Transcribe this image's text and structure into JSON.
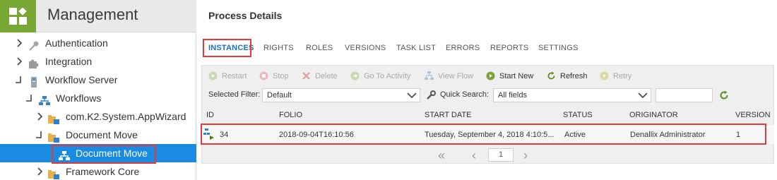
{
  "sidebar": {
    "title": "Management",
    "items": [
      {
        "label": "Authentication",
        "expander": "›"
      },
      {
        "label": "Integration",
        "expander": "›"
      },
      {
        "label": "Workflow Server",
        "expander": "⌟"
      },
      {
        "label": "Workflows",
        "expander": "⌟"
      },
      {
        "label": "com.K2.System.AppWizard",
        "expander": "›"
      },
      {
        "label": "Document Move",
        "expander": "⌟"
      },
      {
        "label": "Document Move",
        "expander": ""
      },
      {
        "label": "Framework Core",
        "expander": "›"
      }
    ]
  },
  "main": {
    "title": "Process Details",
    "tabs": [
      "INSTANCES",
      "RIGHTS",
      "ROLES",
      "VERSIONS",
      "TASK LIST",
      "ERRORS",
      "REPORTS",
      "SETTINGS"
    ],
    "toolbar": {
      "restart": "Restart",
      "stop": "Stop",
      "delete": "Delete",
      "goto_activity": "Go To Activity",
      "view_flow": "View Flow",
      "start_new": "Start New",
      "refresh": "Refresh",
      "retry": "Retry"
    },
    "filter": {
      "selected_filter_label": "Selected Filter:",
      "selected_filter_value": "Default",
      "quick_search_label": "Quick Search:",
      "quick_search_value": "All fields",
      "search_text": ""
    },
    "table": {
      "columns": [
        "ID",
        "FOLIO",
        "START DATE",
        "STATUS",
        "ORIGINATOR",
        "VERSION"
      ],
      "rows": [
        [
          "34",
          "2018-09-04T16:10:56",
          "Tuesday, September 4, 2018 4:10:5...",
          "Active",
          "Denallix Administrator",
          "1"
        ]
      ]
    },
    "pager": {
      "first": "«",
      "prev": "‹",
      "page": "1",
      "next": "›"
    }
  },
  "colors": {
    "accent": "#1a8be0",
    "brand_green": "#78a735",
    "highlight": "#e03a3a"
  }
}
